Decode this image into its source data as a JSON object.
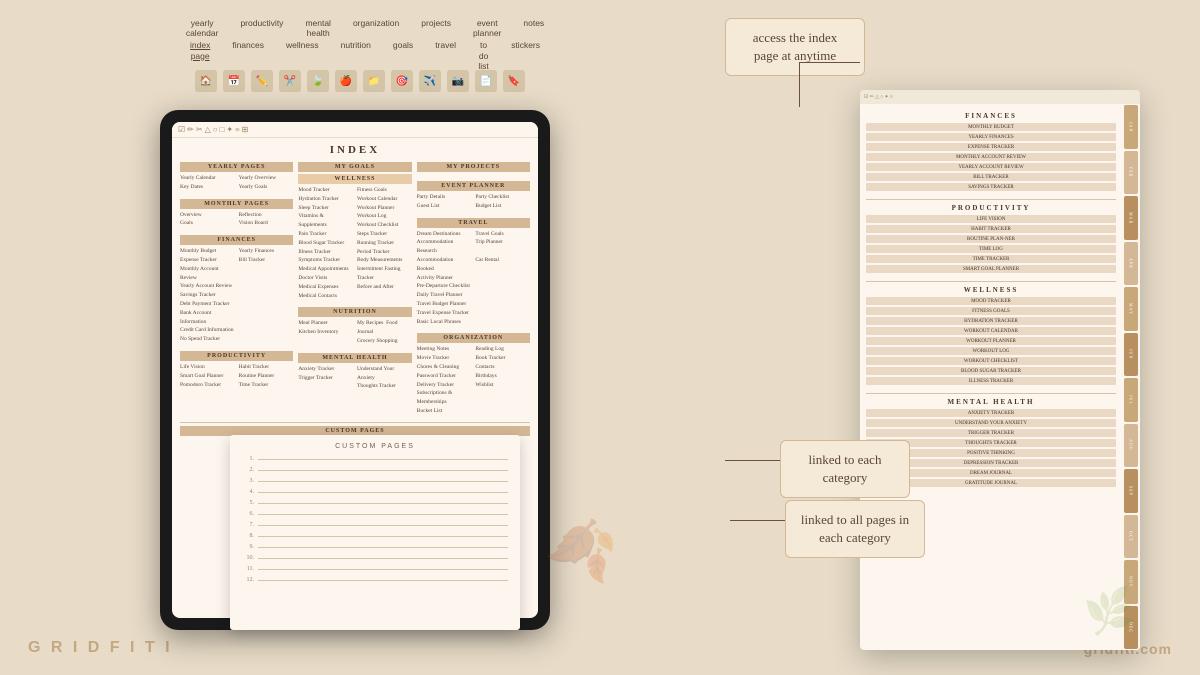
{
  "brand": {
    "left": "G R I D F I T I",
    "right": "gridfiti.com"
  },
  "callouts": {
    "top": "access the index page at anytime",
    "mid": "linked to each category",
    "bottom": "linked to all pages in each category"
  },
  "nav": {
    "row1": [
      "yearly calendar",
      "productivity",
      "mental health",
      "organization",
      "projects",
      "event planner",
      "notes"
    ],
    "row2": [
      "index page",
      "finances",
      "wellness",
      "nutrition",
      "goals",
      "travel",
      "to do list",
      "stickers"
    ]
  },
  "index": {
    "title": "INDEX",
    "sections": {
      "yearly": {
        "header": "YEARLY PAGES",
        "items": [
          "Yearly Calendar",
          "Yearly Overview",
          "Key Dates",
          "Yearly Goals"
        ]
      },
      "monthly": {
        "header": "MONTHLY PAGES",
        "items": [
          "Overview",
          "Reflection",
          "Goals",
          "Vision Board"
        ]
      },
      "finances": {
        "header": "FINANCES",
        "items": [
          "Monthly Budget",
          "Yearly Finances",
          "Expense Tracker",
          "Bill Tracker",
          "Monthly Account Review",
          "Yearly Account Review",
          "Savings Tracker",
          "Debt Payment Tracker",
          "Bank Account Information",
          "Credit Card Information",
          "No Spend Tracker"
        ]
      },
      "productivity": {
        "header": "PRODUCTIVITY",
        "items": [
          "Life Vision",
          "Habit Tracker",
          "Smart Goal Planner",
          "Routine Planner",
          "Pomodoro Tracker",
          "Time Tracker"
        ]
      },
      "myGoals": {
        "header": "MY GOALS",
        "sub": "WELLNESS",
        "items": [
          "Mood Tracker",
          "Fitness Goals",
          "Hydration Tracker",
          "Workout Calendar",
          "Sleep Tracker",
          "Workout Planner",
          "Vitamins & Supplements",
          "Workout Log",
          "Pain Tracker",
          "Workout Checklist",
          "Blood Sugar Tracker",
          "Steps Tracker",
          "Illness Tracker",
          "Running Tracker",
          "Symptoms Tracker",
          "Period Tracker",
          "Medical Appointments",
          "Body Measurements",
          "Doctor Visits",
          "Intermittent Fasting Tracker",
          "Medical Expenses",
          "Before and After",
          "Medical Contacts",
          ""
        ]
      },
      "nutrition": {
        "header": "NUTRITION",
        "items": [
          "Meal Planner",
          "My Recipes",
          "Food Journal",
          "Kitchen Inventory",
          "Grocery Shopping"
        ]
      },
      "mentalHealth": {
        "header": "MENTAL HEALTH",
        "items": [
          "Anxiety Tracker",
          "Understand Your Anxiety",
          "Trigger Tracker",
          "Thoughts Tracker"
        ]
      },
      "myProjects": {
        "header": "MY PROJECTS"
      },
      "eventPlanner": {
        "header": "EVENT PLANNER",
        "items": [
          "Party Details",
          "Party Checklist",
          "Guest List",
          "Budget List"
        ]
      },
      "travel": {
        "header": "TRAVEL",
        "items": [
          "Dream Destinations",
          "Travel Goals",
          "Accommodation Research",
          "Trip Planner",
          "Accommodation Booked",
          "",
          "Activity Planner",
          "Car Rental",
          "Pre-Departure Checklist",
          "Daily Travel Planner",
          "Travel Budget Planner",
          "Travel Expense Tracker",
          "Basic Local Phrases"
        ]
      },
      "organization": {
        "header": "ORGANIZATION",
        "items": [
          "Meeting Notes",
          "Reading Log",
          "Movie Tracker",
          "Book Tracker",
          "Chores & Cleaning",
          "Contacts",
          "Password Tracker",
          "Birthdays",
          "Delivery Tracker",
          "Wishlist",
          "Subscriptions & Memberships",
          "",
          "Bucket List"
        ]
      },
      "customPages": {
        "header": "CUSTOM PAGES",
        "lines": [
          "1.",
          "2.",
          "3.",
          "4.",
          "5.",
          "6.",
          "7.",
          "8.",
          "9.",
          "10.",
          "11.",
          "12."
        ]
      }
    }
  },
  "planner": {
    "sections": [
      {
        "title": "FINANCES",
        "items": [
          "MONTHLY BUDGET",
          "YEARLY FINANCES",
          "EXPENSE TRACKER",
          "MONTHLY ACCOUNT REVIEW",
          "YEARLY ACCOUNT REVIEW",
          "BILL TRACKER",
          "SAVINGS TRACKER"
        ]
      },
      {
        "title": "PRODUCTIVITY",
        "items": [
          "LIFE VISION",
          "HABIT TRACKER",
          "ROUTINE PLAN-NER",
          "TIME LOG",
          "TIME TRACKER",
          "SMART GOAL PLANNER"
        ]
      },
      {
        "title": "WELLNESS",
        "items": [
          "MOOD TRACKER",
          "FITNESS GOALS",
          "HYDRATION TRACKER",
          "WORKOUT CALENDAR",
          "WORKOUT PLANNER",
          "WORKOUT LOG",
          "WORKOUT CHECKLIST",
          "BLOOD SUGAR TRACKER",
          "ILLNESS TRACKER"
        ]
      },
      {
        "title": "MENTAL HEALTH",
        "items": [
          "ANXIETY TRACKER",
          "UNDERSTAND YOUR ANXIETY",
          "TRIGGER TRACKER",
          "THOUGHTS TRACKER",
          "POSITIVE THINKING",
          "DEPRESSION TRACKER",
          "DREAM JOURNAL",
          "GRATITUDE JOURNAL"
        ]
      }
    ],
    "sideTabs": [
      "JAN",
      "FEB",
      "MAR",
      "APR",
      "MAY",
      "JUN",
      "JUL",
      "AUG",
      "SEP",
      "OCT",
      "NOV",
      "DEC"
    ]
  }
}
